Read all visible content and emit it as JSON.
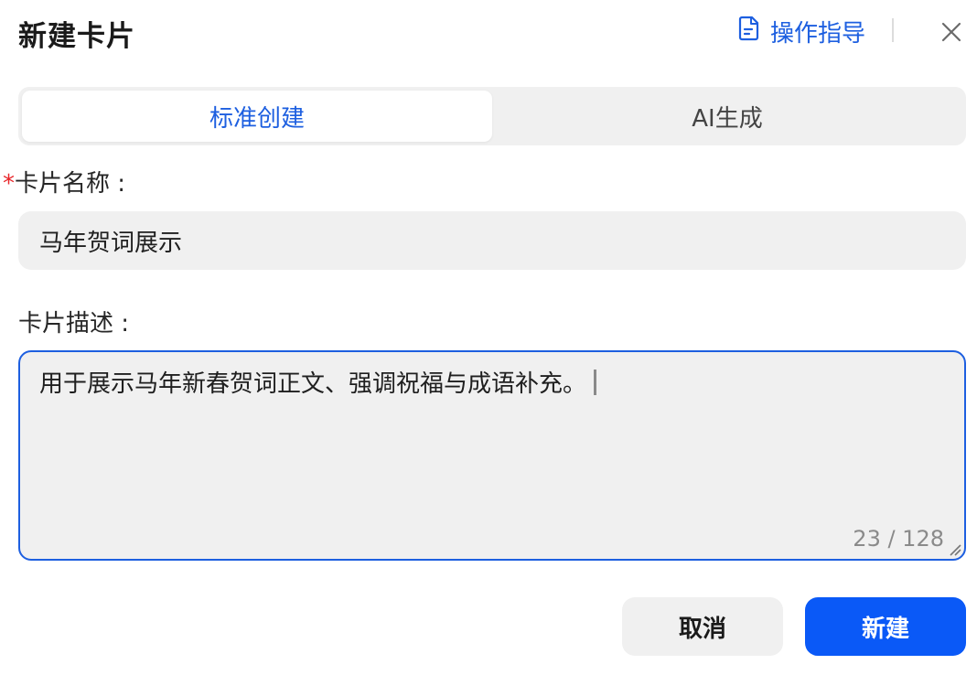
{
  "dialog": {
    "title": "新建卡片",
    "guide_label": "操作指导"
  },
  "tabs": [
    {
      "label": "标准创建",
      "active": true
    },
    {
      "label": "AI生成",
      "active": false
    }
  ],
  "form": {
    "name": {
      "required_mark": "*",
      "label": "卡片名称 :",
      "value": "马年贺词展示"
    },
    "description": {
      "label": "卡片描述 :",
      "value": "用于展示马年新春贺词正文、强调祝福与成语补充。",
      "counter": "23 / 128"
    }
  },
  "buttons": {
    "cancel": "取消",
    "create": "新建"
  },
  "colors": {
    "accent": "#1d5fe0",
    "primary_button": "#0a59f7",
    "required": "#e8262a",
    "field_bg": "#f0f0f0"
  },
  "icons": {
    "guide": "document-icon",
    "close": "close-icon",
    "resize": "resize-handle-icon"
  }
}
